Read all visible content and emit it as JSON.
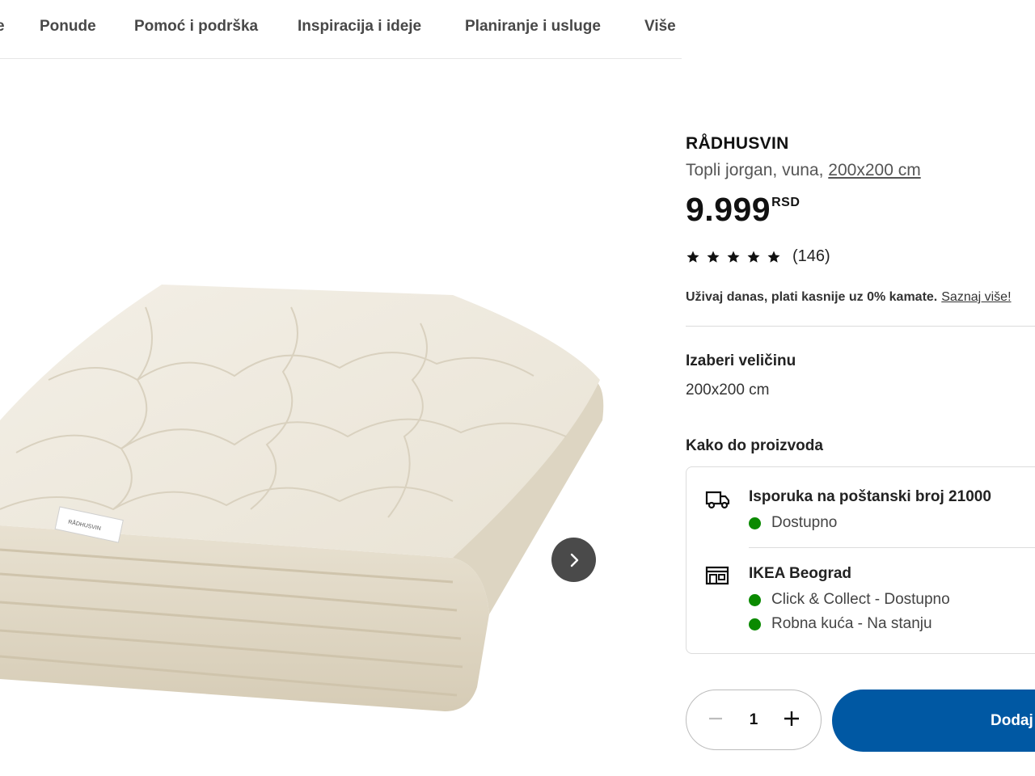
{
  "nav": {
    "items": [
      "e",
      "Ponude",
      "Pomoć i podrška",
      "Inspiracija i ideje",
      "Planiranje i usluge",
      "Više"
    ]
  },
  "gallery": {
    "label_text": "RÅDHUSVIN"
  },
  "product": {
    "name": "RÅDHUSVIN",
    "description": "Topli jorgan, vuna,",
    "size_link": "200x200 cm",
    "price": "9.999",
    "currency": "RSD",
    "rating": {
      "stars": 5,
      "max": 5,
      "count": "(146)"
    },
    "finance_text": "Uživaj danas, plati kasnije uz 0% kamate.",
    "finance_link": "Saznaj više!"
  },
  "size": {
    "title": "Izaberi veličinu",
    "value": "200x200 cm"
  },
  "availability": {
    "title": "Kako do proizvoda",
    "delivery": {
      "title": "Isporuka na poštanski broj 21000",
      "status": "Dostupno",
      "icon": "truck-icon"
    },
    "store": {
      "title": "IKEA Beograd",
      "click_collect": "Click & Collect - Dostupno",
      "in_store": "Robna kuća - Na stanju",
      "icon": "store-icon"
    },
    "status_color": "#0a8a00"
  },
  "purchase": {
    "quantity": "1",
    "add_label": "Dodaj",
    "button_color": "#0058a3"
  }
}
